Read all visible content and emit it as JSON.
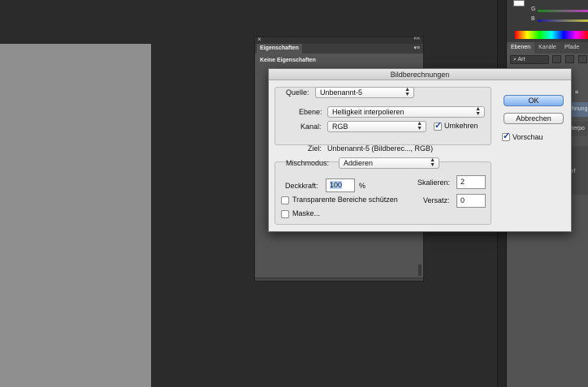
{
  "properties_panel": {
    "tab": "Eigenschaften",
    "content": "Keine Eigenschaften"
  },
  "color_panel": {
    "g_label": "G",
    "b_label": "B"
  },
  "layers_panel": {
    "tabs": [
      "Ebenen",
      "Kanäle",
      "Pfade"
    ],
    "kind_filter": "Art",
    "row_text": "hnung",
    "row_text2": "terpo",
    "row_text3": "rf"
  },
  "dialog": {
    "title": "Bildberechnungen",
    "source_label": "Quelle:",
    "source_value": "Unbenannt-5",
    "layer_label": "Ebene:",
    "layer_value": "Helligkeit interpolieren",
    "channel_label": "Kanal:",
    "channel_value": "RGB",
    "invert_label": "Umkehren",
    "invert_checked": true,
    "target_label": "Ziel:",
    "target_value": "Unbenannt-5 (Bildberec..., RGB)",
    "blend_label": "Mischmodus:",
    "blend_value": "Addieren",
    "opacity_label": "Deckkraft:",
    "opacity_value": "100",
    "opacity_unit": "%",
    "scale_label": "Skalieren:",
    "scale_value": "2",
    "offset_label": "Versatz:",
    "offset_value": "0",
    "preserve_transparency_label": "Transparente Bereiche schützen",
    "mask_label": "Maske...",
    "ok_label": "OK",
    "cancel_label": "Abbrechen",
    "preview_label": "Vorschau",
    "preview_checked": true
  }
}
